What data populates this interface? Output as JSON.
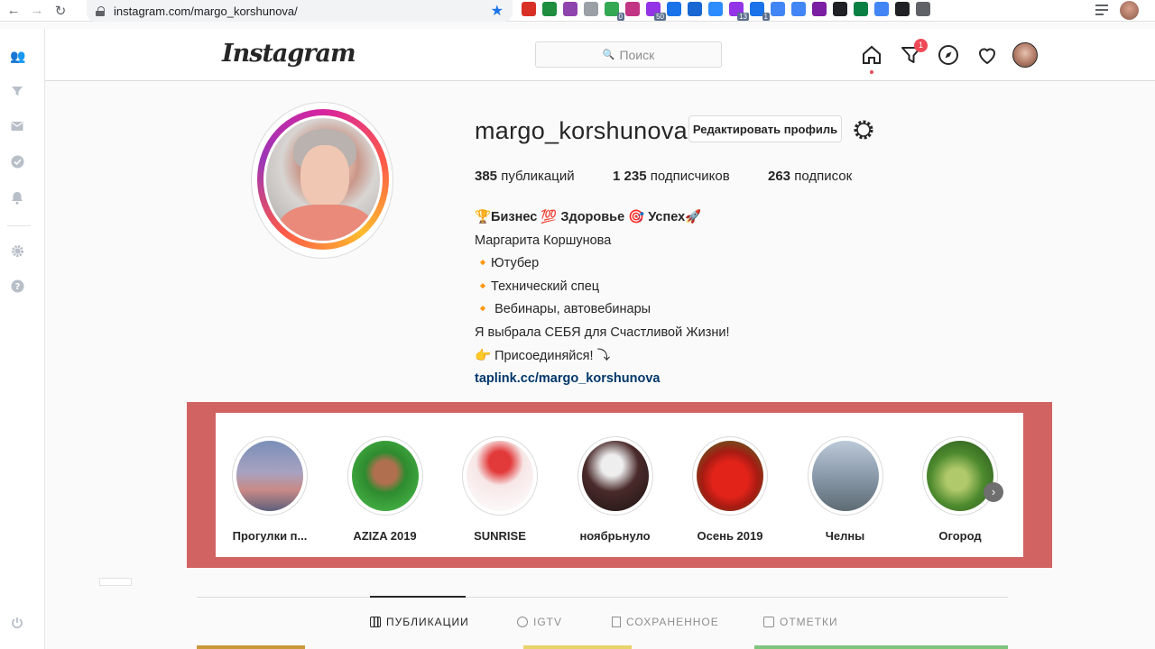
{
  "browser": {
    "url": "instagram.com/margo_korshunova/",
    "extensions": [
      {
        "name": "ext-diamond-icon",
        "color": "#d93025"
      },
      {
        "name": "ext-target-icon",
        "color": "#1e8e3e"
      },
      {
        "name": "ext-feather-icon",
        "color": "#8e44ad"
      },
      {
        "name": "ext-gray-circle-icon",
        "color": "#9aa0a6"
      },
      {
        "name": "ext-shield-icon",
        "color": "#34a853",
        "badge": "0"
      },
      {
        "name": "ext-instagram-icon",
        "color": "#c13584"
      },
      {
        "name": "ext-cycle-icon",
        "color": "#9334e6",
        "badge": "50"
      },
      {
        "name": "ext-iq-icon",
        "color": "#1a73e8"
      },
      {
        "name": "ext-square-icon",
        "color": "#1967d2"
      },
      {
        "name": "ext-zoom-icon",
        "color": "#2d8cff"
      },
      {
        "name": "ext-at-icon",
        "color": "#9334e6",
        "badge": "13"
      },
      {
        "name": "ext-send-icon",
        "color": "#1a73e8",
        "badge": "1"
      },
      {
        "name": "ext-doc-icon",
        "color": "#4285f4"
      },
      {
        "name": "ext-g-icon",
        "color": "#4285f4"
      },
      {
        "name": "ext-hex-icon",
        "color": "#7b1fa2"
      },
      {
        "name": "ext-dark-icon",
        "color": "#202124"
      },
      {
        "name": "ext-gallery-icon",
        "color": "#0b8043"
      },
      {
        "name": "ext-translate-icon",
        "color": "#4285f4"
      },
      {
        "name": "ext-lt-icon",
        "color": "#202124"
      },
      {
        "name": "ext-tb-icon",
        "color": "#5f6368"
      }
    ]
  },
  "header": {
    "logo": "Instagram",
    "search_placeholder": "Поиск",
    "notification_count": "1"
  },
  "profile": {
    "username": "margo_korshunova",
    "edit_label": "Редактировать профиль",
    "stats": {
      "posts_count": "385",
      "posts_label": "публикаций",
      "followers_count": "1 235",
      "followers_label": "подписчиков",
      "following_count": "263",
      "following_label": "подписок"
    },
    "bio": {
      "title": "🏆Бизнес 💯 Здоровье 🎯 Успех🚀",
      "name": "Маргарита Коршунова",
      "line1": "🔸Ютубер",
      "line2": "🔸Технический спец",
      "line3": "🔸 Вебинары, автовебинары",
      "line4": "Я выбрала СЕБЯ для Счастливой Жизни!",
      "line5": "👉 Присоединяйся! ⤵",
      "link": "taplink.cc/margo_korshunova"
    }
  },
  "highlights": [
    {
      "label": "Прогулки п...",
      "bg": "linear-gradient(180deg,#7a8fb8 0%,#a7a2c0 45%,#c98a86 70%,#5d5f7c 100%)"
    },
    {
      "label": "AZIZA 2019",
      "bg": "radial-gradient(circle at 50% 45%,#b07050 0 22%,#2e8b2e 40%,#4fc24f 100%)"
    },
    {
      "label": "SUNRISE",
      "bg": "radial-gradient(circle at 50% 30%,#e23a3a 0 18%,#f7e7e7 40%,#ffffff 100%)"
    },
    {
      "label": "ноябрьнуло",
      "bg": "radial-gradient(circle at 45% 35%,#eeeeee 0 18%,#4a2a2a 45%,#1a1212 100%)"
    },
    {
      "label": "Осень 2019",
      "bg": "radial-gradient(circle at 50% 55%,#e2231a 0 35%,#a61b12 55%,#3f7d2a 100%)"
    },
    {
      "label": "Челны",
      "bg": "linear-gradient(180deg,#bcc9d8 0%,#8a9aaa 50%,#5d6b74 100%)"
    },
    {
      "label": "Огород",
      "bg": "radial-gradient(circle at 45% 55%,#b0c96a 0 20%,#4d8a2e 50%,#24501a 100%)"
    }
  ],
  "tabs": [
    {
      "label": "ПУБЛИКАЦИИ",
      "active": true
    },
    {
      "label": "IGTV",
      "active": false
    },
    {
      "label": "СОХРАНЕННОЕ",
      "active": false
    },
    {
      "label": "ОТМЕТКИ",
      "active": false
    }
  ]
}
